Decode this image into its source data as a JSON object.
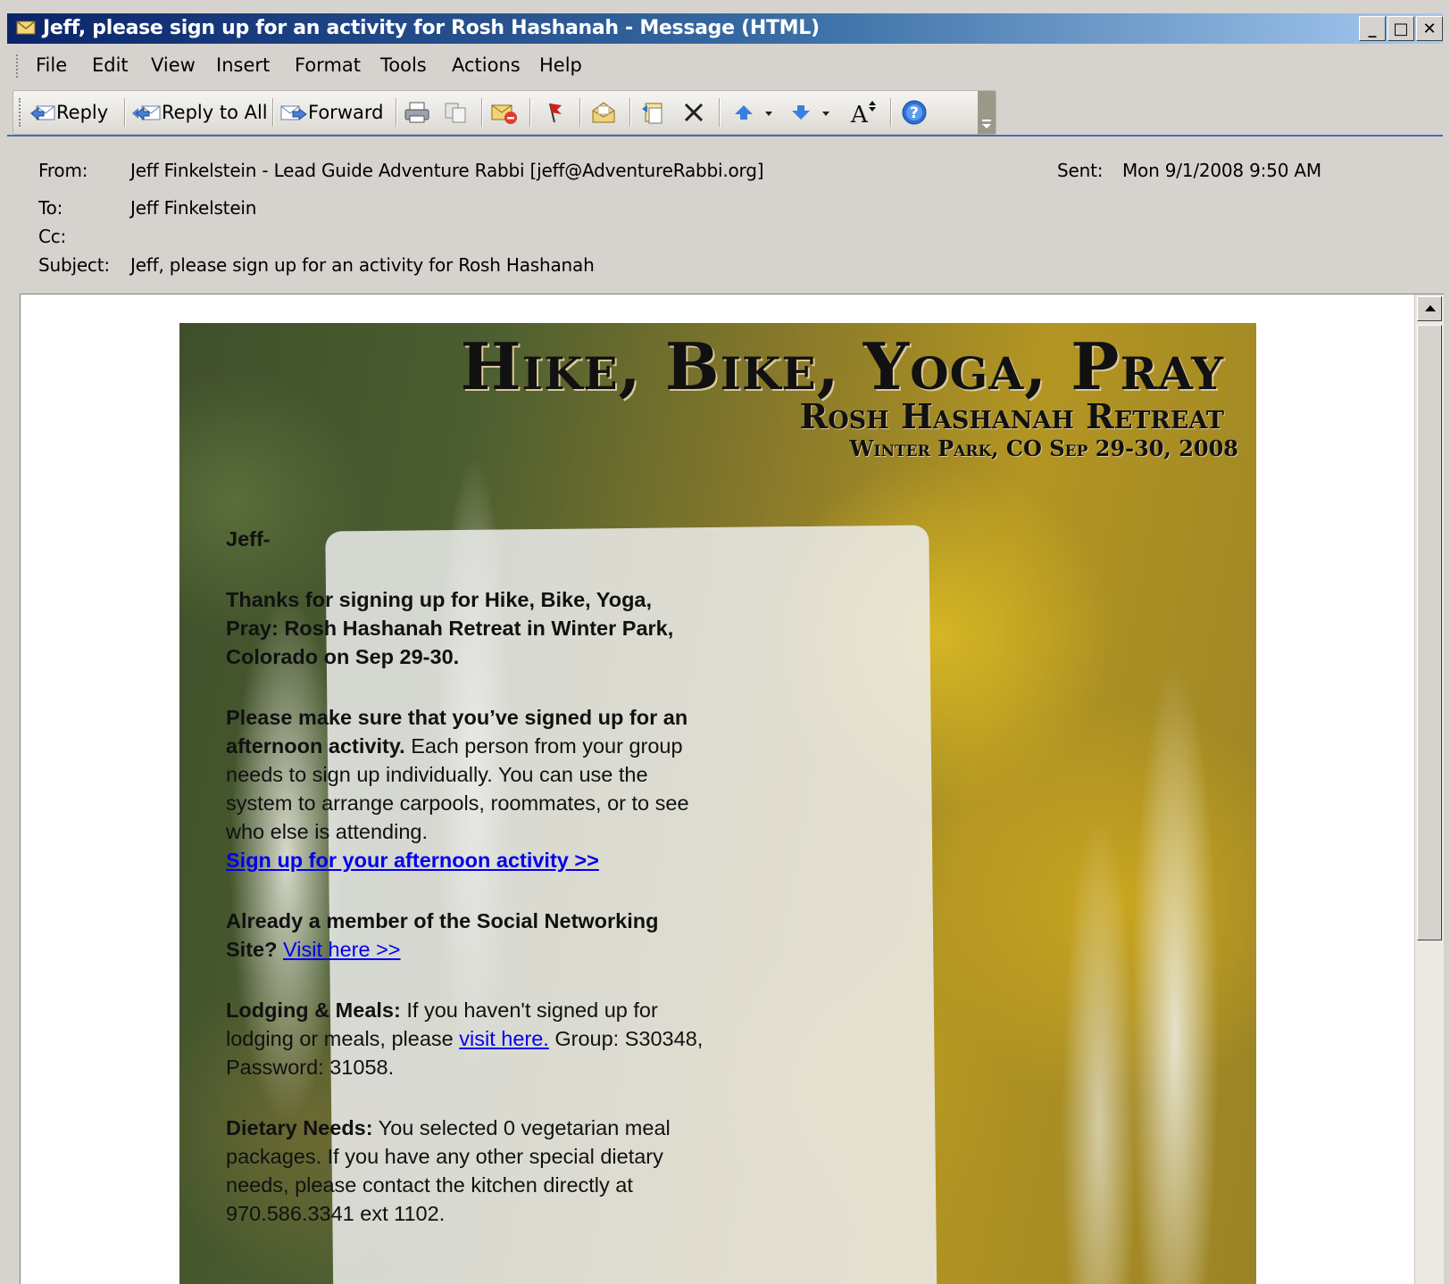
{
  "window": {
    "title": "Jeff, please sign up for an activity for Rosh Hashanah - Message (HTML)",
    "controls": {
      "minimize": "_",
      "maximize": "□",
      "close": "✕"
    }
  },
  "menu": [
    "File",
    "Edit",
    "View",
    "Insert",
    "Format",
    "Tools",
    "Actions",
    "Help"
  ],
  "toolbar": {
    "reply": "Reply",
    "reply_all": "Reply to All",
    "forward": "Forward"
  },
  "header": {
    "from_label": "From:",
    "from_value": "Jeff Finkelstein - Lead Guide Adventure Rabbi [jeff@AdventureRabbi.org]",
    "sent_label": "Sent:",
    "sent_value": "Mon 9/1/2008 9:50 AM",
    "to_label": "To:",
    "to_value": "Jeff Finkelstein",
    "cc_label": "Cc:",
    "subject_label": "Subject:",
    "subject_value": "Jeff, please sign up for an activity for Rosh Hashanah"
  },
  "banner": {
    "title": "Hike, Bike, Yoga, Pray",
    "subtitle": "Rosh Hashanah Retreat",
    "location": "Winter Park, CO Sep 29-30, 2008"
  },
  "message": {
    "greeting": "Jeff-",
    "p1": "Thanks for signing up for Hike, Bike, Yoga, Pray: Rosh Hashanah Retreat in Winter Park, Colorado on Sep 29-30.",
    "p2_bold": "Please make sure that you’ve signed up for an afternoon activity.",
    "p2_text": " Each person from your group needs to sign up individually. You can use the system to arrange carpools, roommates, or to see who else is attending.",
    "p2_link": "Sign up for your afternoon activity >>",
    "p3_bold": "Already a member of the Social Networking Site?",
    "p3_link": "Visit here >>",
    "p4_bold": "Lodging & Meals:",
    "p4_text1": " If you haven't signed up for lodging or meals, please ",
    "p4_link": "visit here.",
    "p4_text2": " Group: S30348, Password: 31058.",
    "p5_bold": "Dietary Needs:",
    "p5_text": " You selected 0 vegetarian meal packages. If you have any other special dietary needs, please contact the kitchen directly at 970.586.3341 ext 1102."
  }
}
